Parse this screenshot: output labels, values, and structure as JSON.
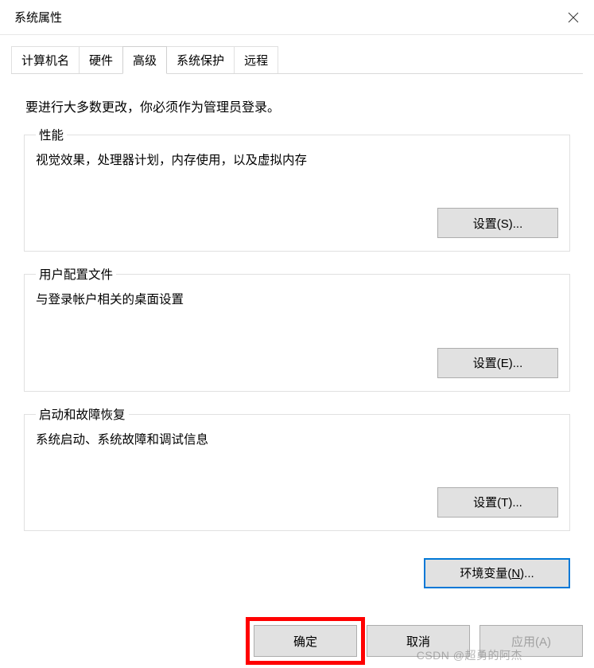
{
  "window": {
    "title": "系统属性"
  },
  "tabs": [
    {
      "label": "计算机名",
      "active": false
    },
    {
      "label": "硬件",
      "active": false
    },
    {
      "label": "高级",
      "active": true
    },
    {
      "label": "系统保护",
      "active": false
    },
    {
      "label": "远程",
      "active": false
    }
  ],
  "admin_note": "要进行大多数更改，你必须作为管理员登录。",
  "groups": {
    "performance": {
      "legend": "性能",
      "desc": "视觉效果，处理器计划，内存使用，以及虚拟内存",
      "button": "设置(S)..."
    },
    "profiles": {
      "legend": "用户配置文件",
      "desc": "与登录帐户相关的桌面设置",
      "button": "设置(E)..."
    },
    "startup": {
      "legend": "启动和故障恢复",
      "desc": "系统启动、系统故障和调试信息",
      "button": "设置(T)..."
    }
  },
  "env_button": {
    "prefix": "环境变量(",
    "mn": "N",
    "suffix": ")..."
  },
  "dialog_buttons": {
    "ok": "确定",
    "cancel": "取消",
    "apply": "应用(A)"
  },
  "watermark": "CSDN @超勇的阿杰"
}
